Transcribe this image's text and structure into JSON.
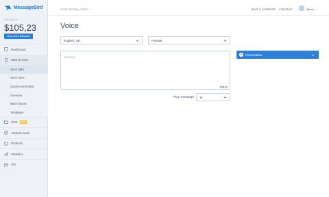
{
  "app": {
    "name": "MessageBird",
    "brand_color": "#2b7cd3",
    "accent": "#2f7fd8"
  },
  "balance": {
    "label": "BALANCE",
    "value": "$105,23",
    "buy_label": "Buy more balance"
  },
  "nav": {
    "dashboard": {
      "label": "Dashboard",
      "icon": "dashboard-icon"
    },
    "sms_voice": {
      "label": "SMS & Voice",
      "icon": "phone-icon"
    },
    "subs": [
      {
        "label": "Send SMS"
      },
      {
        "label": "Send voice"
      },
      {
        "label": "Quickly send SMS"
      },
      {
        "label": "Overview"
      },
      {
        "label": "Batch import"
      },
      {
        "label": "Templates"
      }
    ],
    "chat": {
      "label": "Chat",
      "badge": "NEW",
      "icon": "chat-icon"
    },
    "address_book": {
      "label": "Address book",
      "icon": "address-book-icon"
    },
    "products": {
      "label": "Products",
      "icon": "products-icon"
    },
    "statistics": {
      "label": "Statistics",
      "icon": "statistics-icon"
    },
    "api": {
      "label": "API",
      "icon": "api-icon"
    }
  },
  "header": {
    "greeting": "Good morning, Albert!",
    "help_label": "HELP & SUPPORT",
    "contact_label": "CONTACT",
    "user_name": "Albert"
  },
  "main": {
    "title": "Voice",
    "language_value": "English, UK",
    "gender_value": "Female",
    "message_placeholder": "Message",
    "counter": "0/510",
    "play_label": "Play message",
    "play_value": "1x",
    "personalize_label": "Personalize"
  }
}
